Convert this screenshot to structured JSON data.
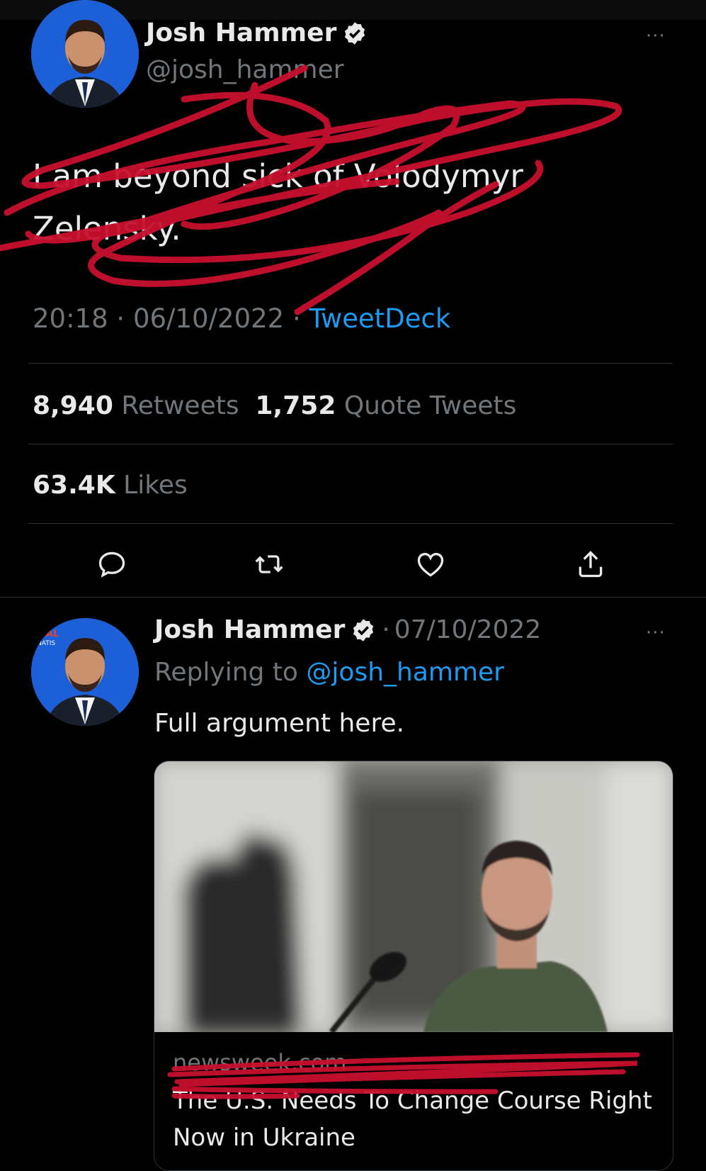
{
  "main_tweet": {
    "author_name": "Josh Hammer",
    "handle": "@josh_hammer",
    "text": "I am beyond sick of Volodymyr Zelensky.",
    "time": "20:18",
    "date": "06/10/2022",
    "meta_sep": "·",
    "source": "TweetDeck",
    "retweets_count": "8,940",
    "retweets_label": "Retweets",
    "quotes_count": "1,752",
    "quotes_label": "Quote Tweets",
    "likes_count": "63.4K",
    "likes_label": "Likes",
    "more_label": "···"
  },
  "reply_tweet": {
    "author_name": "Josh Hammer",
    "date_sep": "·",
    "date": "07/10/2022",
    "replying_label": "Replying to",
    "replying_handle": "@josh_hammer",
    "text": "Full argument here.",
    "more_label": "···",
    "avatar_badge_text": "NAL\nNATIS",
    "card": {
      "domain": "newsweek.com",
      "title": "The U.S. Needs To Change Course Right Now in Ukraine"
    }
  },
  "icons": {
    "verified": "verified-badge-icon",
    "reply": "reply-icon",
    "retweet": "retweet-icon",
    "like": "like-icon",
    "share": "share-icon"
  },
  "colors": {
    "background": "#000000",
    "accent": "#1d9bf0",
    "muted": "#71767b",
    "scribble": "#c8102e"
  }
}
